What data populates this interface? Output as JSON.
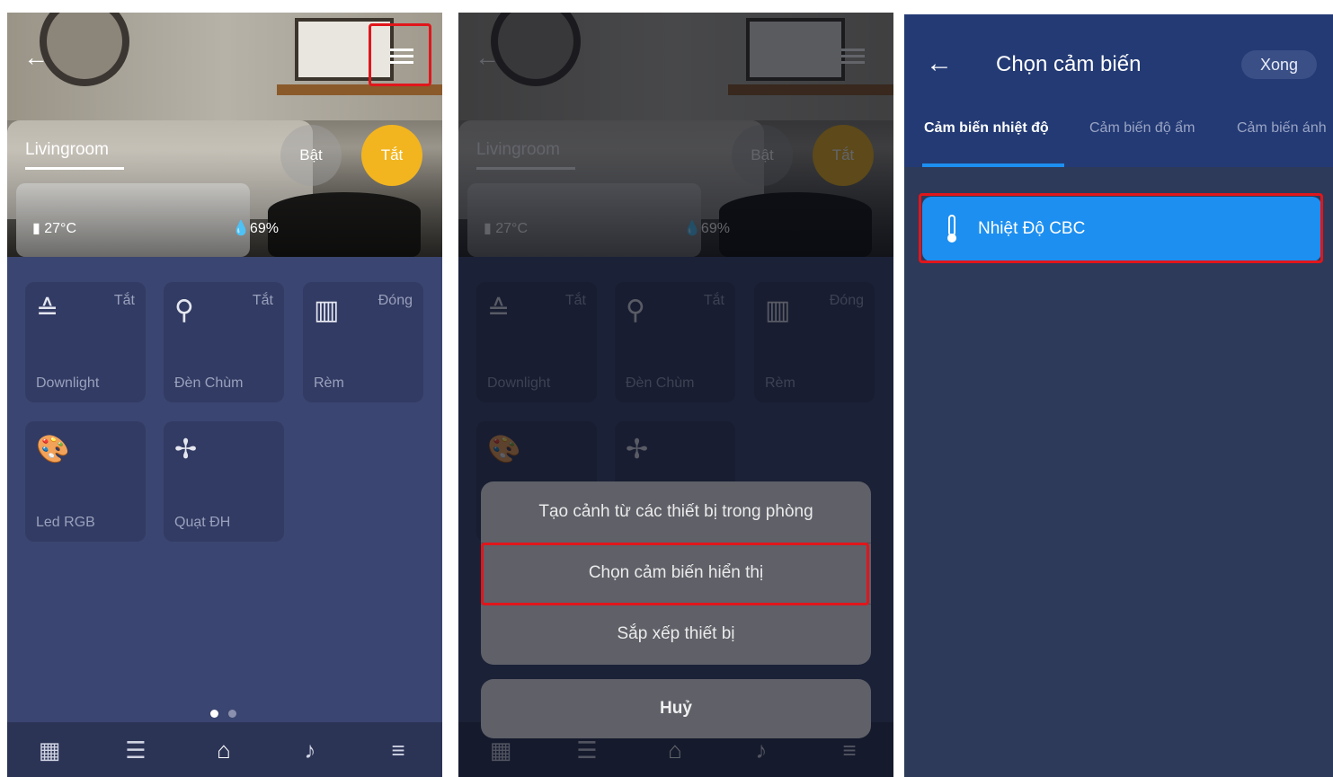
{
  "room_screen": {
    "room_name": "Livingroom",
    "btn_on": "Bật",
    "btn_off": "Tắt",
    "temperature": "27°C",
    "humidity": "69%",
    "devices": [
      {
        "name": "Downlight",
        "state": "Tắt",
        "icon": "ceiling-light-icon"
      },
      {
        "name": "Đèn Chùm",
        "state": "Tắt",
        "icon": "chandelier-icon"
      },
      {
        "name": "Rèm",
        "state": "Đóng",
        "icon": "curtain-icon"
      },
      {
        "name": "Led RGB",
        "state": "",
        "icon": "palette-icon"
      },
      {
        "name": "Quạt ĐH",
        "state": "",
        "icon": "fan-icon"
      }
    ],
    "nav": [
      "dashboard-icon",
      "list-icon",
      "home-icon",
      "music-icon",
      "menu-icon"
    ]
  },
  "action_sheet": {
    "items": [
      "Tạo cảnh từ các thiết bị trong phòng",
      "Chọn cảm biến hiển thị",
      "Sắp xếp thiết bị"
    ],
    "cancel": "Huỷ"
  },
  "sensor_screen": {
    "title": "Chọn cảm biến",
    "done": "Xong",
    "tabs": [
      "Cảm biến nhiệt độ",
      "Cảm biến độ ẩm",
      "Cảm biến ánh"
    ],
    "sensors": [
      {
        "name": "Nhiệt Độ CBC",
        "icon": "thermometer-icon"
      }
    ]
  },
  "colors": {
    "accent_yellow": "#f2b51f",
    "highlight_red": "#e0161b",
    "selected_blue": "#1d8ff0",
    "panel_bg": "#3b4571"
  }
}
